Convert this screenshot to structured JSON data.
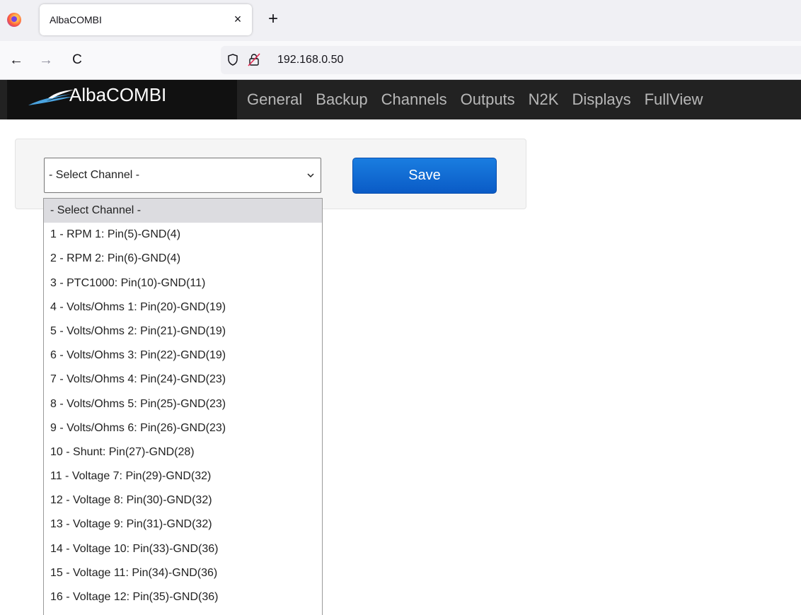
{
  "browser": {
    "tab_title": "AlbaCOMBI",
    "tab_close": "×",
    "new_tab": "+",
    "url": "192.168.0.50",
    "back": "←",
    "forward": "→",
    "reload": "C"
  },
  "app": {
    "brand": "AlbaCOMBI",
    "menu": [
      "General",
      "Backup",
      "Channels",
      "Outputs",
      "N2K",
      "Displays",
      "FullView"
    ]
  },
  "form": {
    "select_value": "- Select Channel -",
    "save_label": "Save"
  },
  "dropdown": {
    "selected_index": 0,
    "options": [
      "- Select Channel -",
      "1 - RPM 1: Pin(5)-GND(4)",
      "2 - RPM 2: Pin(6)-GND(4)",
      "3 - PTC1000: Pin(10)-GND(11)",
      "4 - Volts/Ohms 1: Pin(20)-GND(19)",
      "5 - Volts/Ohms 2: Pin(21)-GND(19)",
      "6 - Volts/Ohms 3: Pin(22)-GND(19)",
      "7 - Volts/Ohms 4: Pin(24)-GND(23)",
      "8 - Volts/Ohms 5: Pin(25)-GND(23)",
      "9 - Volts/Ohms 6: Pin(26)-GND(23)",
      "10 - Shunt: Pin(27)-GND(28)",
      "11 - Voltage 7: Pin(29)-GND(32)",
      "12 - Voltage 8: Pin(30)-GND(32)",
      "13 - Voltage 9: Pin(31)-GND(32)",
      "14 - Voltage 10: Pin(33)-GND(36)",
      "15 - Voltage 11: Pin(34)-GND(36)",
      "16 - Voltage 12: Pin(35)-GND(36)"
    ]
  },
  "colors": {
    "appbar": "#222222",
    "save_button": "#0a5bc6"
  },
  "icons": [
    "firefox-logo-icon",
    "shield-icon",
    "lock-icon",
    "chevron-down-icon",
    "brand-bird-icon"
  ]
}
